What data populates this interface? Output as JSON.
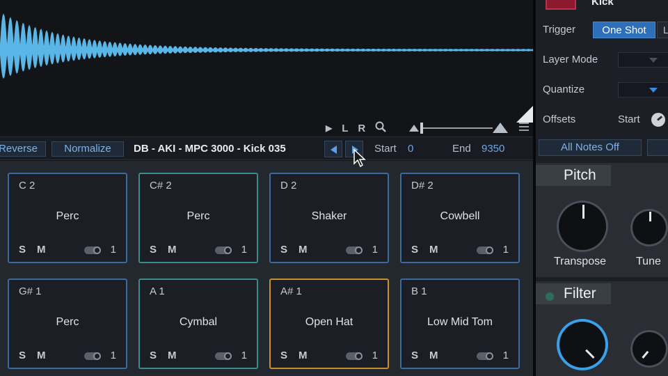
{
  "colors": {
    "waveform": "#5ab6e6",
    "accent_blue": "#2d6fb8",
    "pad_border_blue": "#3a6aa0",
    "pad_border_teal": "#3b8a8c",
    "pad_border_selected": "#c8902c",
    "pad_color_swatch": "#8a1a2c"
  },
  "waveform_tools": {
    "play_icon": "play-icon",
    "left_label": "L",
    "right_label": "R",
    "zoom_icon": "magnifier-icon"
  },
  "sample_bar": {
    "reverse_label": "Reverse",
    "normalize_label": "Normalize",
    "sample_name": "DB - AKI - MPC 3000 - Kick 035",
    "start_label": "Start",
    "start_value": "0",
    "end_label": "End",
    "end_value": "9350"
  },
  "pads": [
    {
      "note": "C 2",
      "name": "Perc",
      "solo": "S",
      "mute": "M",
      "layers": "1"
    },
    {
      "note": "C# 2",
      "name": "Perc",
      "solo": "S",
      "mute": "M",
      "layers": "1"
    },
    {
      "note": "D 2",
      "name": "Shaker",
      "solo": "S",
      "mute": "M",
      "layers": "1"
    },
    {
      "note": "D# 2",
      "name": "Cowbell",
      "solo": "S",
      "mute": "M",
      "layers": "1"
    },
    {
      "note": "G# 1",
      "name": "Perc",
      "solo": "S",
      "mute": "M",
      "layers": "1"
    },
    {
      "note": "A 1",
      "name": "Cymbal",
      "solo": "S",
      "mute": "M",
      "layers": "1"
    },
    {
      "note": "A# 1",
      "name": "Open Hat",
      "solo": "S",
      "mute": "M",
      "layers": "1"
    },
    {
      "note": "B 1",
      "name": "Low Mid Tom",
      "solo": "S",
      "mute": "M",
      "layers": "1"
    }
  ],
  "right_panel": {
    "pad_title": "Kick",
    "trigger_label": "Trigger",
    "trigger_one_shot": "One Shot",
    "trigger_other": "L",
    "layer_mode_label": "Layer Mode",
    "quantize_label": "Quantize",
    "offsets_label": "Offsets",
    "offsets_start_label": "Start",
    "all_notes_off": "All Notes Off",
    "pitch_section": "Pitch",
    "transpose_label": "Transpose",
    "tune_label": "Tune",
    "filter_section": "Filter"
  }
}
